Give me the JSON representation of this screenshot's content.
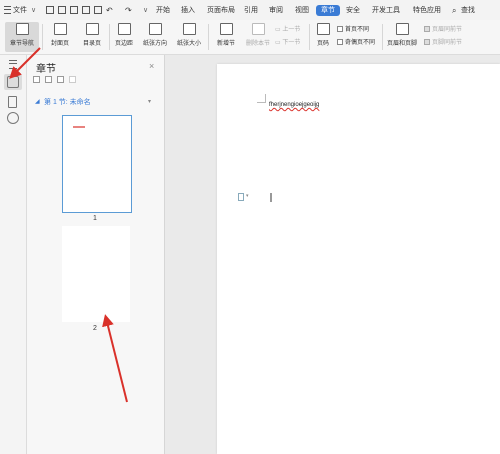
{
  "menubar": {
    "file": "文件",
    "tabs": [
      "开始",
      "插入",
      "页面布局",
      "引用",
      "审阅",
      "视图",
      "章节",
      "安全",
      "开发工具",
      "特色应用"
    ],
    "active_tab": "章节",
    "search": "查找"
  },
  "ribbon": {
    "chapter_nav": "章节导航",
    "cover": "封面页",
    "toc": "目录页",
    "margins": "页边距",
    "orientation": "纸张方向",
    "size": "纸张大小",
    "new_section": "新增节",
    "delete_section": "删除本节",
    "prev_section": "上一节",
    "next_section": "下一节",
    "page_number": "页码",
    "first_diff": "首页不同",
    "odd_even_diff": "奇偶页不同",
    "header_footer": "页眉和页脚",
    "same_prev_header": "页眉同前节",
    "same_prev_footer": "页脚同前节"
  },
  "nav_panel": {
    "title": "章节",
    "section_label": "第 1 节: 未命名",
    "pages": [
      {
        "label": "1"
      },
      {
        "label": "2"
      }
    ]
  },
  "document": {
    "text": "fherjnengioejgeoijg"
  },
  "colors": {
    "accent": "#3a7bd5",
    "arrow": "#d9312a",
    "selected_border": "#5b9bd5"
  }
}
